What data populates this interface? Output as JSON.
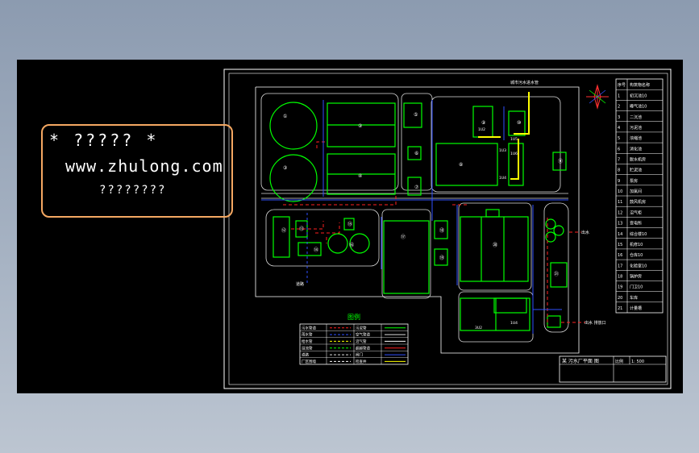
{
  "watermark": {
    "line1": "* ????? *",
    "line2": "www.zhulong.com",
    "line3": "????????"
  },
  "title_block": {
    "drawing_title": "某 污水厂平面 图",
    "cells": [
      "比例",
      "1: 500"
    ]
  },
  "plan_labels": {
    "top_pipe": "城市污水进水管",
    "buildings": [
      "①",
      "②",
      "③",
      "④",
      "⑤",
      "⑥",
      "⑦",
      "⑧",
      "⑨",
      "⑩",
      "⑪",
      "⑫",
      "⑬",
      "⑭",
      "⑮",
      "⑯",
      "⑰",
      "⑱",
      "⑲",
      "⑳",
      "㉑"
    ],
    "small_tags": [
      "1U2",
      "1U3",
      "1U4",
      "1U5",
      "1U6",
      "3U2",
      "1U4"
    ],
    "outlet1": "出水",
    "outlet2": "出水 排放口",
    "road": "道路"
  },
  "legend_list": [
    {
      "no": "序号",
      "name": "构筑物名称"
    },
    {
      "no": "1",
      "name": "初沉池10"
    },
    {
      "no": "2",
      "name": "曝气池10"
    },
    {
      "no": "3",
      "name": "二沉池"
    },
    {
      "no": "4",
      "name": "污泥池"
    },
    {
      "no": "5",
      "name": "浓缩池"
    },
    {
      "no": "6",
      "name": "消化池"
    },
    {
      "no": "7",
      "name": "脱水机房"
    },
    {
      "no": "8",
      "name": "贮泥池"
    },
    {
      "no": "9",
      "name": "泵房"
    },
    {
      "no": "10",
      "name": "加氯间"
    },
    {
      "no": "11",
      "name": "鼓风机房"
    },
    {
      "no": "12",
      "name": "沼气柜"
    },
    {
      "no": "13",
      "name": "变电所"
    },
    {
      "no": "14",
      "name": "综合楼10"
    },
    {
      "no": "15",
      "name": "机修10"
    },
    {
      "no": "16",
      "name": "仓库10"
    },
    {
      "no": "17",
      "name": "化验室10"
    },
    {
      "no": "18",
      "name": "锅炉房"
    },
    {
      "no": "19",
      "name": "门卫10"
    },
    {
      "no": "20",
      "name": "车库"
    },
    {
      "no": "21",
      "name": "计量槽"
    }
  ],
  "pipe_legend": {
    "title": "图例",
    "rows": [
      [
        "污水管道",
        "",
        "污泥管",
        ""
      ],
      [
        "雨水管",
        "",
        "空气管道",
        ""
      ],
      [
        "给水管",
        "",
        "沼气管",
        ""
      ],
      [
        "溢流管",
        "",
        "超越管道",
        ""
      ],
      [
        "道路",
        "",
        "阀门",
        ""
      ],
      [
        "厂区围墙",
        "",
        "检查井",
        ""
      ]
    ]
  },
  "colors": {
    "wall": "#ffffff",
    "building": "#00ff00",
    "sludge": "#ff2020",
    "water": "#3050ff",
    "air": "#ffff00",
    "road": "#dddddd",
    "accent": "#f5a862"
  }
}
